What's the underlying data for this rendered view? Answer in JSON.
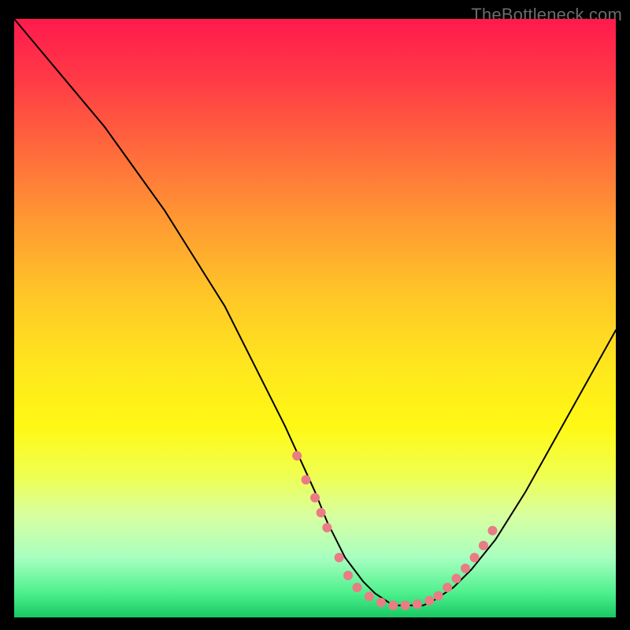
{
  "attribution": "TheBottleneck.com",
  "chart_data": {
    "type": "line",
    "title": "",
    "xlabel": "",
    "ylabel": "",
    "xlim": [
      0,
      100
    ],
    "ylim": [
      0,
      100
    ],
    "grid": false,
    "series": [
      {
        "name": "bottleneck-curve",
        "x": [
          0,
          5,
          10,
          15,
          20,
          25,
          30,
          35,
          40,
          45,
          50,
          52,
          55,
          58,
          60,
          63,
          65,
          68,
          70,
          73,
          76,
          80,
          85,
          90,
          95,
          100
        ],
        "y": [
          100,
          94,
          88,
          82,
          75,
          68,
          60,
          52,
          42,
          32,
          21,
          16,
          10,
          6,
          4,
          2,
          2,
          2,
          3,
          5,
          8,
          13,
          21,
          30,
          39,
          48
        ]
      }
    ],
    "markers": {
      "name": "valley-dots",
      "color": "#e97c84",
      "radius_px": 6,
      "points_xy": [
        [
          47,
          27
        ],
        [
          48.5,
          23
        ],
        [
          50,
          20
        ],
        [
          51,
          17.5
        ],
        [
          52,
          15
        ],
        [
          54,
          10
        ],
        [
          55.5,
          7
        ],
        [
          57,
          5
        ],
        [
          59,
          3.5
        ],
        [
          61,
          2.5
        ],
        [
          63,
          2
        ],
        [
          65,
          2
        ],
        [
          67,
          2.2
        ],
        [
          69,
          2.8
        ],
        [
          70.5,
          3.6
        ],
        [
          72,
          5
        ],
        [
          73.5,
          6.5
        ],
        [
          75,
          8.2
        ],
        [
          76.5,
          10
        ],
        [
          78,
          12
        ],
        [
          79.5,
          14.5
        ]
      ]
    }
  },
  "colors": {
    "gradient_top": "#ff1a4d",
    "gradient_bottom": "#18c864",
    "curve": "#000000",
    "marker": "#e97c84"
  }
}
